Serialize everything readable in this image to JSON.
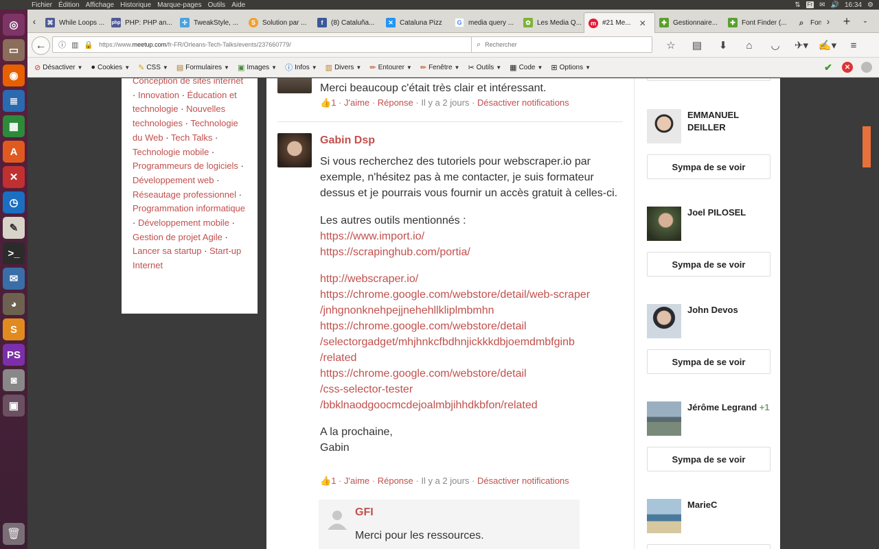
{
  "os_menu": [
    "Fichier",
    "Édition",
    "Affichage",
    "Historique",
    "Marque-pages",
    "Outils",
    "Aide"
  ],
  "os_tray": {
    "keyboard": "Fr",
    "time": "16:34"
  },
  "tabs": [
    {
      "label": "While Loops ...",
      "favicon": "php-doc-icon",
      "color": "#4f5b93"
    },
    {
      "label": "PHP: PHP an...",
      "favicon": "php-icon",
      "color": "#4f5b93"
    },
    {
      "label": "TweakStyle, ...",
      "favicon": "tweak-icon",
      "color": "#4aa3df"
    },
    {
      "label": "Solution par ...",
      "favicon": "solution-icon",
      "color": "#f0a030"
    },
    {
      "label": "(8) Cataluña...",
      "favicon": "facebook-icon",
      "color": "#3b5998"
    },
    {
      "label": "Cataluna Pizz",
      "favicon": "cross-icon",
      "color": "#2196f3"
    },
    {
      "label": "media query ...",
      "favicon": "google-icon",
      "color": "#4285f4"
    },
    {
      "label": "Les Media Q...",
      "favicon": "leaf-icon",
      "color": "#7bb33a"
    },
    {
      "label": "#21 Me...",
      "favicon": "meetup-icon",
      "color": "#e51937",
      "active": true
    },
    {
      "label": "Gestionnaire...",
      "favicon": "puzzle-icon",
      "color": "#5aa02c"
    },
    {
      "label": "Font Finder (...",
      "favicon": "puzzle-icon",
      "color": "#5aa02c"
    },
    {
      "label": "Fon",
      "favicon": "search-icon",
      "color": "#555"
    }
  ],
  "url": {
    "prefix": "https://www.",
    "domain": "meetup.com",
    "path": "/fr-FR/Orleans-Tech-Talks/events/237660779/"
  },
  "search": {
    "placeholder": "Rechercher"
  },
  "addons": [
    {
      "label": "Désactiver",
      "icon": "disable-icon"
    },
    {
      "label": "Cookies",
      "icon": "cookie-icon"
    },
    {
      "label": "CSS",
      "icon": "css-icon"
    },
    {
      "label": "Formulaires",
      "icon": "form-icon"
    },
    {
      "label": "Images",
      "icon": "image-icon"
    },
    {
      "label": "Infos",
      "icon": "info-icon"
    },
    {
      "label": "Divers",
      "icon": "misc-icon"
    },
    {
      "label": "Entourer",
      "icon": "outline-icon"
    },
    {
      "label": "Fenêtre",
      "icon": "window-icon"
    },
    {
      "label": "Outils",
      "icon": "tools-icon"
    },
    {
      "label": "Code",
      "icon": "code-icon"
    },
    {
      "label": "Options",
      "icon": "options-icon"
    }
  ],
  "topics": {
    "items": [
      "Conception de sites internet",
      "Innovation",
      "Éducation et technologie",
      "Nouvelles technologies",
      "Technologie du Web",
      "Tech Talks",
      "Technologie mobile",
      "Programmeurs de logiciels",
      "Développement web",
      "Réseautage professionnel",
      "Programmation informatique",
      "Développement mobile",
      "Gestion de projet Agile",
      "Lancer sa startup",
      "Start-up Internet"
    ]
  },
  "comment1": {
    "text": "Merci beaucoup c'était très clair et intéressant.",
    "likes": "1",
    "like_label": "J'aime",
    "reply_label": "Réponse",
    "time": "Il y a 2 jours",
    "notify_label": "Désactiver notifications"
  },
  "comment2": {
    "author": "Gabin Dsp",
    "p1": "Si vous recherchez des tutoriels pour webscraper.io par exemple, n'hésitez pas à me contacter, je suis formateur dessus et je pourrais vous fournir un accès gratuit à celles-ci.",
    "p2": "Les autres outils mentionnés :",
    "links_a": [
      "https://www.import.io/",
      "https://scrapinghub.com/portia/"
    ],
    "links_b": [
      "http://webscraper.io/",
      "https://chrome.google.com/webstore/detail/web-scraper",
      "/jnhgnonknehpejjnehehllkliplmbmhn",
      "https://chrome.google.com/webstore/detail",
      "/selectorgadget/mhjhnkcfbdhnjickkkdbjoemdmbfginb",
      "/related",
      "https://chrome.google.com/webstore/detail",
      "/css-selector-tester",
      "/bbklnaodgoocmcdejoalmbjihhdkbfon/related"
    ],
    "closing1": "A la prochaine,",
    "closing2": "Gabin",
    "likes": "1",
    "like_label": "J'aime",
    "reply_label": "Réponse",
    "time": "Il y a 2 jours",
    "notify_label": "Désactiver notifications"
  },
  "reply": {
    "author": "GFI",
    "text": "Merci pour les ressources."
  },
  "attendees": [
    {
      "name": "EMMANUEL DEILLER",
      "extra": "",
      "button": "Sympa de se voir"
    },
    {
      "name": "Joel PILOSEL",
      "extra": "",
      "button": "Sympa de se voir"
    },
    {
      "name": "John Devos",
      "extra": "",
      "button": "Sympa de se voir"
    },
    {
      "name": "Jérôme Legrand",
      "extra": "+1",
      "button": "Sympa de se voir"
    },
    {
      "name": "MarieC",
      "extra": "",
      "button": ""
    }
  ]
}
